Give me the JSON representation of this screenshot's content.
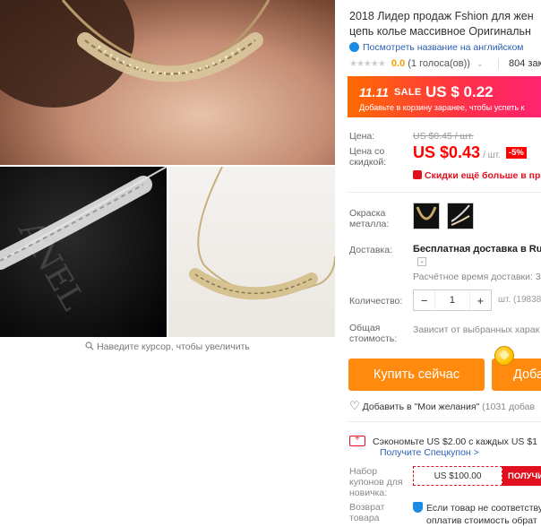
{
  "gallery": {
    "zoom_hint": "Наведите курсор, чтобы увеличить"
  },
  "product": {
    "title_line1": "2018 Лидер продаж Fshion для жен",
    "title_line2": "цепь колье массивное Оригинальн",
    "translate_link": "Посмотреть название на английском",
    "rating": {
      "value": "0.0",
      "count": "(1 голоса(ов))",
      "orders": "804 зака",
      "stars_filled": 0,
      "stars_total": 5
    }
  },
  "promo": {
    "tag": "11.11",
    "sale": "SALE",
    "price": "US $ 0.22",
    "note": "Добавьте в корзину заранее, чтобы успеть к"
  },
  "pricing": {
    "price_label": "Цена:",
    "old_price": "US $0.45 / шт.",
    "discount_label_line1": "Цена со",
    "discount_label_line2": "скидкой:",
    "new_price": "US $0.43",
    "unit": "/ шт.",
    "discount": "-5%",
    "cheaper_text": "Скидки ещё больше в при"
  },
  "options": {
    "color_label_line1": "Окраска",
    "color_label_line2": "металла:",
    "swatches": [
      "gold-necklace-swatch",
      "silver-necklace-swatch"
    ]
  },
  "shipping": {
    "label": "Доставка:",
    "value": "Бесплатная доставка в Russ",
    "estimate": "Расчётное время доставки: 3"
  },
  "quantity": {
    "label": "Количество:",
    "value": "1",
    "minus": "−",
    "plus": "+",
    "available": "шт. (19838"
  },
  "total": {
    "label_line1": "Общая",
    "label_line2": "стоимость:",
    "value": "Зависит от выбранных харак"
  },
  "actions": {
    "buy_now": "Купить сейчас",
    "add_to_cart": "Доба",
    "wishlist": "Добавить в \"Мои желания\"",
    "wishlist_count": "(1031 добав"
  },
  "coupons": {
    "save_text": "Сэкономьте US $2.00 с каждых US $1",
    "special_link": "Получите Спецкупон >",
    "new_user_label_line1": "Набор",
    "new_user_label_line2": "купонов для",
    "new_user_label_line3": "новичка:",
    "coupon_value": "US $100.00",
    "get_button": "ПОЛУЧИТ"
  },
  "returns": {
    "label_line1": "Возврат",
    "label_line2": "товара",
    "line1": "Если товар не соответству",
    "line2": "оплатив стоимость обрат"
  },
  "colors": {
    "accent_orange": "#ff8a0e",
    "price_red": "#f00",
    "link_blue": "#2a5fb5",
    "promo_start": "#ff6b00",
    "promo_end": "#ff1f7d"
  }
}
